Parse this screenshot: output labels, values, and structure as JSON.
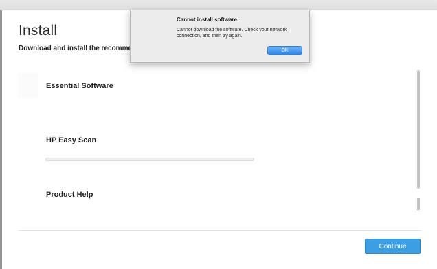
{
  "page": {
    "title": "Install",
    "subtitle": "Download and install the recommended"
  },
  "software": {
    "items": [
      {
        "label": "Essential Software"
      },
      {
        "label": "HP Easy Scan",
        "progress": 0
      },
      {
        "label": "Product Help"
      }
    ]
  },
  "footer": {
    "continue_label": "Continue"
  },
  "alert": {
    "title": "Cannot install software.",
    "message": "Cannot download the software. Check your network connection, and then try again.",
    "ok_label": "OK"
  },
  "colors": {
    "accent": "#3c9ee3",
    "alert_button": "#2c85e9"
  }
}
